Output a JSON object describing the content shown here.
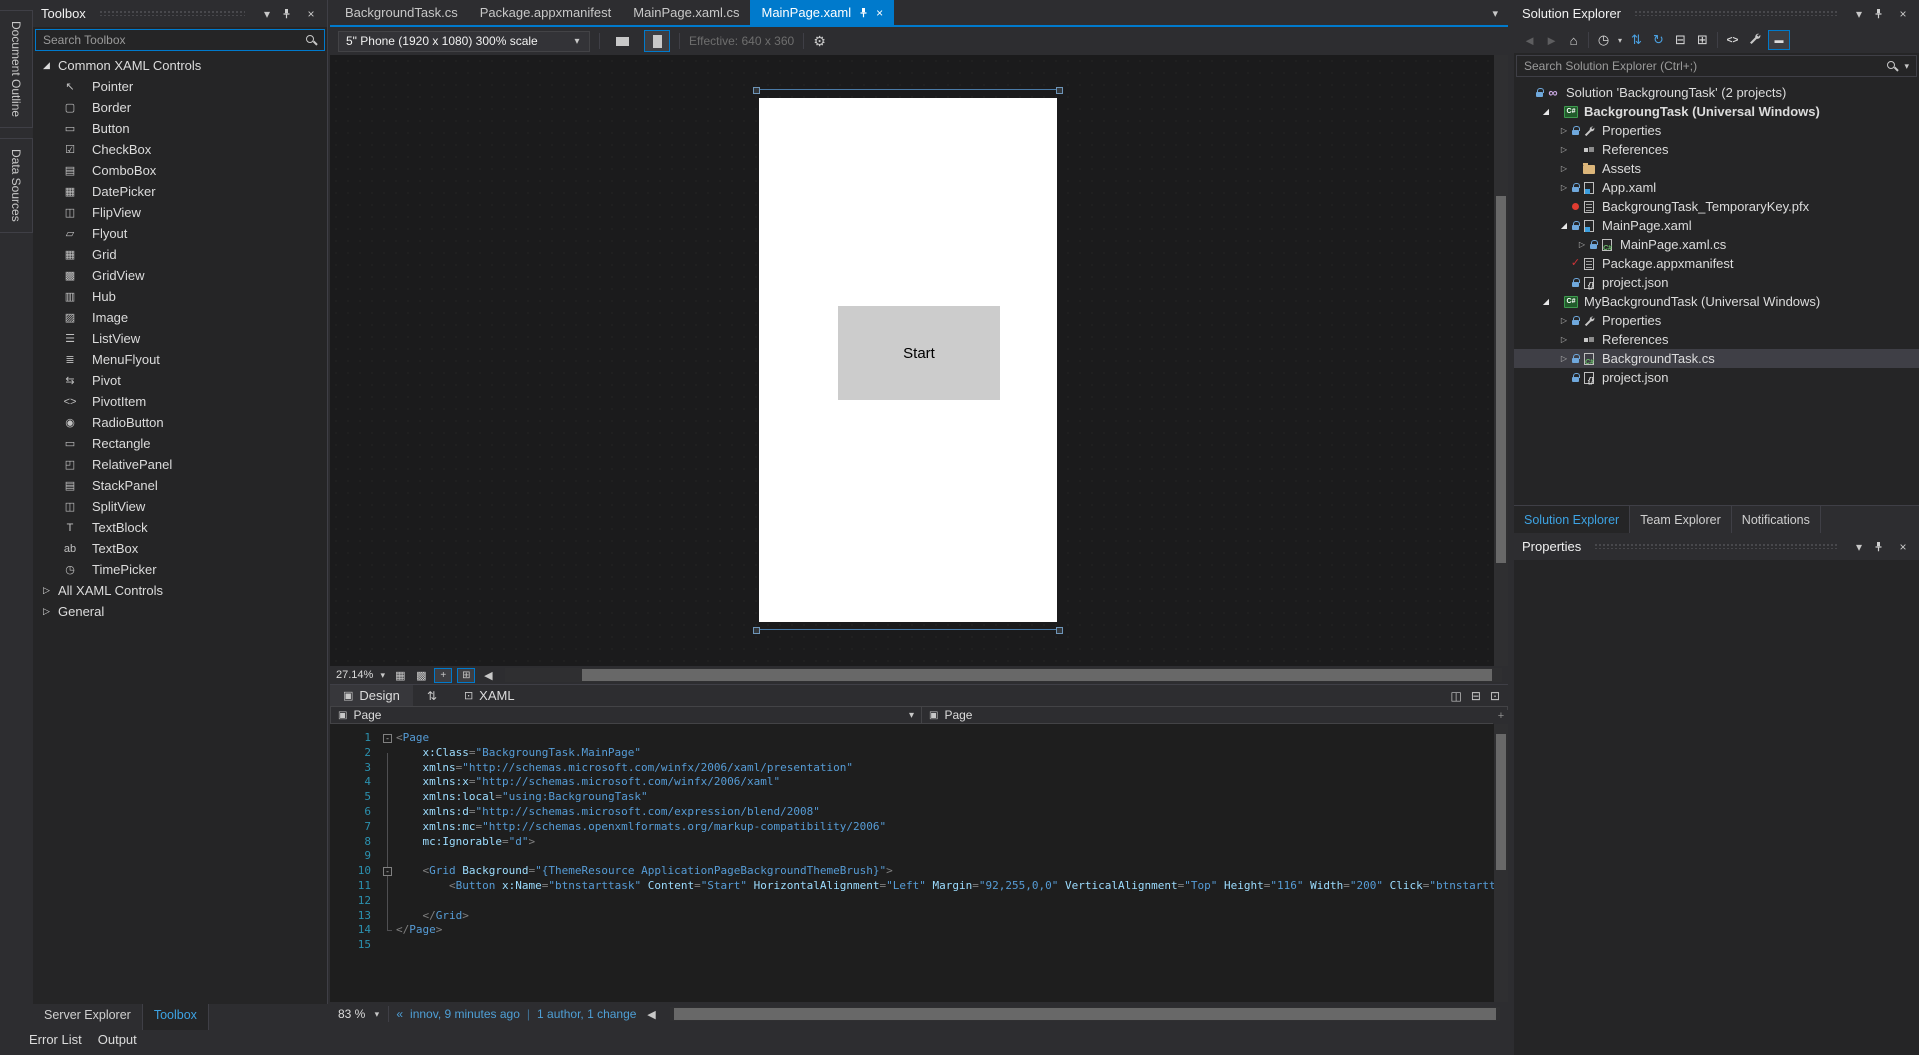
{
  "icons": {
    "caret_down": "▾",
    "close": "×",
    "home": "⌂",
    "back": "◄",
    "forward": "►",
    "clock": "◷",
    "sync": "⇅",
    "refresh": "↻",
    "collapse_all": "⊟",
    "show_all": "⊞",
    "view_code": "<>",
    "preview_dash": "▬",
    "left_arrow": "◀",
    "gear": "⚙",
    "swap": "⇅",
    "split_vertical": "◫",
    "split_horizontal": "⊟",
    "expand_pane": "⊡",
    "breadcrumb_tag": "▣",
    "design_tab": "▣",
    "xaml_tab": "⊡",
    "grid_small": "▦",
    "grid_dots": "▩",
    "snap_grid": "+",
    "snap_lines": "⊞",
    "pan_cross": "+",
    "expander_open": "◢",
    "expander_closed": "▷",
    "solution_glyph": "∞",
    "cs_tag": "C#",
    "json_tag": "{}",
    "fold_minus": "-"
  },
  "colors": {
    "accent": "#007ACC",
    "selection": "#3F3F46",
    "editor_bg": "#1E1E1E",
    "line_number": "#2B91AF",
    "codelens_blue": "#4E9FD6"
  },
  "left_strip": {
    "tabs": [
      {
        "label": "Document Outline"
      },
      {
        "label": "Data Sources"
      }
    ]
  },
  "toolbox": {
    "title": "Toolbox",
    "search_placeholder": "Search Toolbox",
    "groups": [
      {
        "label": "Common XAML Controls",
        "expanded": true,
        "items": [
          {
            "label": "Pointer",
            "icon": "pointer",
            "glyph": "↖"
          },
          {
            "label": "Border",
            "icon": "border",
            "glyph": "▢"
          },
          {
            "label": "Button",
            "icon": "button",
            "glyph": "▭"
          },
          {
            "label": "CheckBox",
            "icon": "checkbox",
            "glyph": "☑"
          },
          {
            "label": "ComboBox",
            "icon": "combobox",
            "glyph": "▤"
          },
          {
            "label": "DatePicker",
            "icon": "datepicker",
            "glyph": "▦"
          },
          {
            "label": "FlipView",
            "icon": "flipview",
            "glyph": "◫"
          },
          {
            "label": "Flyout",
            "icon": "flyout",
            "glyph": "▱"
          },
          {
            "label": "Grid",
            "icon": "grid",
            "glyph": "▦"
          },
          {
            "label": "GridView",
            "icon": "gridview",
            "glyph": "▩"
          },
          {
            "label": "Hub",
            "icon": "hub",
            "glyph": "▥"
          },
          {
            "label": "Image",
            "icon": "image",
            "glyph": "▨"
          },
          {
            "label": "ListView",
            "icon": "listview",
            "glyph": "☰"
          },
          {
            "label": "MenuFlyout",
            "icon": "menuflyout",
            "glyph": "≣"
          },
          {
            "label": "Pivot",
            "icon": "pivot",
            "glyph": "⇆"
          },
          {
            "label": "PivotItem",
            "icon": "pivotitem",
            "glyph": "<>"
          },
          {
            "label": "RadioButton",
            "icon": "radiobutton",
            "glyph": "◉"
          },
          {
            "label": "Rectangle",
            "icon": "rectangle",
            "glyph": "▭"
          },
          {
            "label": "RelativePanel",
            "icon": "relativepanel",
            "glyph": "◰"
          },
          {
            "label": "StackPanel",
            "icon": "stackpanel",
            "glyph": "▤"
          },
          {
            "label": "SplitView",
            "icon": "splitview",
            "glyph": "◫"
          },
          {
            "label": "TextBlock",
            "icon": "textblock",
            "glyph": "T"
          },
          {
            "label": "TextBox",
            "icon": "textbox",
            "glyph": "ab"
          },
          {
            "label": "TimePicker",
            "icon": "timepicker",
            "glyph": "◷"
          }
        ]
      },
      {
        "label": "All XAML Controls",
        "expanded": false,
        "items": []
      },
      {
        "label": "General",
        "expanded": false,
        "items": []
      }
    ],
    "bottom_tabs": [
      {
        "label": "Server Explorer",
        "active": false
      },
      {
        "label": "Toolbox",
        "active": true
      }
    ]
  },
  "document_tabs": [
    {
      "label": "BackgroundTask.cs",
      "active": false
    },
    {
      "label": "Package.appxmanifest",
      "active": false
    },
    {
      "label": "MainPage.xaml.cs",
      "active": false
    },
    {
      "label": "MainPage.xaml",
      "active": true
    }
  ],
  "designer": {
    "device_selector": "5\" Phone (1920 x 1080) 300% scale",
    "effective_label": "Effective: 640 x 360",
    "artboard_button_label": "Start",
    "zoom_value": "27.14%"
  },
  "split_bar": {
    "design_label": "Design",
    "xaml_label": "XAML"
  },
  "breadcrumbs": {
    "left": "Page",
    "right": "Page"
  },
  "code": {
    "lines": [
      {
        "n": "1",
        "fold": true,
        "tokens": [
          [
            "p",
            "<"
          ],
          [
            "t",
            "Page"
          ]
        ]
      },
      {
        "n": "2",
        "tokens": [
          [
            "w",
            "    "
          ],
          [
            "a",
            "x:Class"
          ],
          [
            "p",
            "="
          ],
          [
            "v",
            "\"BackgroungTask.MainPage\""
          ]
        ]
      },
      {
        "n": "3",
        "tokens": [
          [
            "w",
            "    "
          ],
          [
            "a",
            "xmlns"
          ],
          [
            "p",
            "="
          ],
          [
            "v",
            "\"http://schemas.microsoft.com/winfx/2006/xaml/presentation\""
          ]
        ]
      },
      {
        "n": "4",
        "tokens": [
          [
            "w",
            "    "
          ],
          [
            "a",
            "xmlns:x"
          ],
          [
            "p",
            "="
          ],
          [
            "v",
            "\"http://schemas.microsoft.com/winfx/2006/xaml\""
          ]
        ]
      },
      {
        "n": "5",
        "tokens": [
          [
            "w",
            "    "
          ],
          [
            "a",
            "xmlns:local"
          ],
          [
            "p",
            "="
          ],
          [
            "v",
            "\"using:BackgroungTask\""
          ]
        ]
      },
      {
        "n": "6",
        "tokens": [
          [
            "w",
            "    "
          ],
          [
            "a",
            "xmlns:d"
          ],
          [
            "p",
            "="
          ],
          [
            "v",
            "\"http://schemas.microsoft.com/expression/blend/2008\""
          ]
        ]
      },
      {
        "n": "7",
        "tokens": [
          [
            "w",
            "    "
          ],
          [
            "a",
            "xmlns:mc"
          ],
          [
            "p",
            "="
          ],
          [
            "v",
            "\"http://schemas.openxmlformats.org/markup-compatibility/2006\""
          ]
        ]
      },
      {
        "n": "8",
        "tokens": [
          [
            "w",
            "    "
          ],
          [
            "a",
            "mc:Ignorable"
          ],
          [
            "p",
            "="
          ],
          [
            "v",
            "\"d\""
          ],
          [
            "p",
            ">"
          ]
        ]
      },
      {
        "n": "9",
        "tokens": []
      },
      {
        "n": "10",
        "fold": true,
        "tokens": [
          [
            "w",
            "    "
          ],
          [
            "p",
            "<"
          ],
          [
            "t",
            "Grid"
          ],
          [
            "w",
            " "
          ],
          [
            "a",
            "Background"
          ],
          [
            "p",
            "="
          ],
          [
            "v",
            "\"{ThemeResource ApplicationPageBackgroundThemeBrush}\""
          ],
          [
            "p",
            ">"
          ]
        ]
      },
      {
        "n": "11",
        "tokens": [
          [
            "w",
            "        "
          ],
          [
            "p",
            "<"
          ],
          [
            "t",
            "Button"
          ],
          [
            "w",
            " "
          ],
          [
            "a",
            "x:Name"
          ],
          [
            "p",
            "="
          ],
          [
            "v",
            "\"btnstarttask\""
          ],
          [
            "w",
            " "
          ],
          [
            "a",
            "Content"
          ],
          [
            "p",
            "="
          ],
          [
            "v",
            "\"Start\""
          ],
          [
            "w",
            " "
          ],
          [
            "a",
            "HorizontalAlignment"
          ],
          [
            "p",
            "="
          ],
          [
            "v",
            "\"Left\""
          ],
          [
            "w",
            " "
          ],
          [
            "a",
            "Margin"
          ],
          [
            "p",
            "="
          ],
          [
            "v",
            "\"92,255,0,0\""
          ],
          [
            "w",
            " "
          ],
          [
            "a",
            "VerticalAlignment"
          ],
          [
            "p",
            "="
          ],
          [
            "v",
            "\"Top\""
          ],
          [
            "w",
            " "
          ],
          [
            "a",
            "Height"
          ],
          [
            "p",
            "="
          ],
          [
            "v",
            "\"116\""
          ],
          [
            "w",
            " "
          ],
          [
            "a",
            "Width"
          ],
          [
            "p",
            "="
          ],
          [
            "v",
            "\"200\""
          ],
          [
            "w",
            " "
          ],
          [
            "a",
            "Click"
          ],
          [
            "p",
            "="
          ],
          [
            "v",
            "\"btnstarttask_Click\""
          ],
          [
            "p",
            "/>"
          ]
        ]
      },
      {
        "n": "12",
        "tokens": []
      },
      {
        "n": "13",
        "tokens": [
          [
            "w",
            "    "
          ],
          [
            "p",
            "</"
          ],
          [
            "t",
            "Grid"
          ],
          [
            "p",
            ">"
          ]
        ]
      },
      {
        "n": "14",
        "tokens": [
          [
            "p",
            "</"
          ],
          [
            "t",
            "Page"
          ],
          [
            "p",
            ">"
          ]
        ]
      },
      {
        "n": "15",
        "tokens": []
      }
    ]
  },
  "editor_status": {
    "zoom": "83 %",
    "codelens_left": "innov, 9 minutes ago",
    "codelens_right": "1 author, 1 change"
  },
  "solution_explorer": {
    "title": "Solution Explorer",
    "search_placeholder": "Search Solution Explorer (Ctrl+;)",
    "tree": [
      {
        "label": "Solution 'BackgroungTask' (2 projects)",
        "depth": 0,
        "icon": "solution",
        "badge": "lock"
      },
      {
        "label": "BackgroungTask (Universal Windows)",
        "depth": 1,
        "icon": "csproj",
        "expander": "open",
        "bold": true
      },
      {
        "label": "Properties",
        "depth": 2,
        "icon": "wrench",
        "expander": "closed",
        "badge": "lock"
      },
      {
        "label": "References",
        "depth": 2,
        "icon": "refs",
        "expander": "closed"
      },
      {
        "label": "Assets",
        "depth": 2,
        "icon": "folder",
        "expander": "closed"
      },
      {
        "label": "App.xaml",
        "depth": 2,
        "icon": "xaml",
        "expander": "closed",
        "badge": "lock"
      },
      {
        "label": "BackgroungTask_TemporaryKey.pfx",
        "depth": 2,
        "icon": "pfx",
        "badge": "reddot"
      },
      {
        "label": "MainPage.xaml",
        "depth": 2,
        "icon": "xaml",
        "expander": "open",
        "badge": "lock"
      },
      {
        "label": "MainPage.xaml.cs",
        "depth": 3,
        "icon": "csfile",
        "expander": "closed",
        "badge": "lock"
      },
      {
        "label": "Package.appxmanifest",
        "depth": 2,
        "icon": "manifest",
        "badge": "redcheck"
      },
      {
        "label": "project.json",
        "depth": 2,
        "icon": "json",
        "badge": "lock"
      },
      {
        "label": "MyBackgroundTask (Universal Windows)",
        "depth": 1,
        "icon": "csproj",
        "expander": "open"
      },
      {
        "label": "Properties",
        "depth": 2,
        "icon": "wrench",
        "expander": "closed",
        "badge": "lock"
      },
      {
        "label": "References",
        "depth": 2,
        "icon": "refs",
        "expander": "closed"
      },
      {
        "label": "BackgroundTask.cs",
        "depth": 2,
        "icon": "csfile",
        "expander": "closed",
        "badge": "lock",
        "selected": true
      },
      {
        "label": "project.json",
        "depth": 2,
        "icon": "json",
        "badge": "lock"
      }
    ],
    "panel_tabs": [
      {
        "label": "Solution Explorer",
        "active": true
      },
      {
        "label": "Team Explorer",
        "active": false
      },
      {
        "label": "Notifications",
        "active": false
      }
    ]
  },
  "properties_panel": {
    "title": "Properties"
  },
  "bottom_panel_tabs": [
    {
      "label": "Error List"
    },
    {
      "label": "Output"
    }
  ]
}
